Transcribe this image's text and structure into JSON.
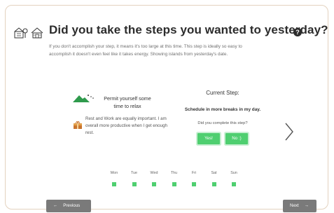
{
  "header": {
    "title": "Did you take the steps you wanted to yesterday?",
    "help_icon": "help-circle-icon",
    "icons": [
      "outdoor-scene-icon",
      "cabin-icon"
    ]
  },
  "intro": {
    "text": "If you don't accomplish your step, it means it's too large at this time. This step is ideally so easy to accomplish it doesn't even feel like it takes energy. Showing islands from yesterday's date."
  },
  "left": {
    "permit_title": "Permit yourself some time to relax",
    "rest_text": "Rest and Work are equally important. I am overall more productive when I get enough rest."
  },
  "right": {
    "current_step_label": "Current Step:",
    "step_name": "Schedule in more breaks in my day.",
    "complete_question": "Did you complete this step?",
    "yes_label": "Yes!",
    "no_label": "No :)"
  },
  "days": [
    "Mon",
    "Tue",
    "Wed",
    "Thu",
    "Fri",
    "Sat",
    "Sun"
  ],
  "nav": {
    "previous_label": "Previous",
    "next_label": "Next",
    "previous_arrow": "←",
    "next_arrow": "→"
  },
  "colors": {
    "accent_green": "#4fcf70",
    "nav_gray": "#7a7a7a",
    "card_border": "#e3d2bf"
  }
}
